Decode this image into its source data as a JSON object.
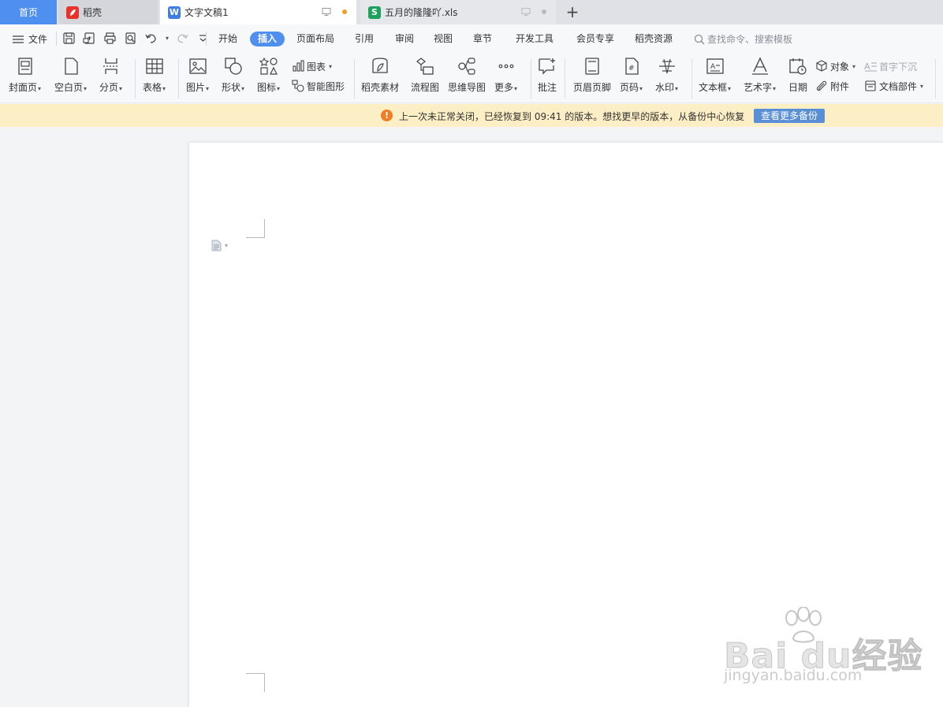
{
  "tabs": {
    "home": "首页",
    "daoke": "稻壳",
    "doc": "文字文稿1",
    "xls": "五月的隆隆吖.xls",
    "add": "+"
  },
  "menu": {
    "file": "文件",
    "items": [
      "开始",
      "插入",
      "页面布局",
      "引用",
      "审阅",
      "视图",
      "章节",
      "开发工具",
      "会员专享",
      "稻壳资源"
    ],
    "active": "插入",
    "search_placeholder": "查找命令、搜索模板"
  },
  "ribbon": {
    "cover": "封面页",
    "blank": "空白页",
    "pagebreak": "分页",
    "table": "表格",
    "picture": "图片",
    "shape": "形状",
    "icon": "图标",
    "chart": "图表",
    "smartart": "智能图形",
    "daoke_material": "稻壳素材",
    "flowchart": "流程图",
    "mindmap": "思维导图",
    "more": "更多",
    "comment": "批注",
    "header_footer": "页眉页脚",
    "page_number": "页码",
    "watermark": "水印",
    "textbox": "文本框",
    "wordart": "艺术字",
    "date": "日期",
    "object": "对象",
    "attachment": "附件",
    "dropcap": "首字下沉",
    "doc_parts": "文档部件"
  },
  "notice": {
    "text": "上一次未正常关闭，已经恢复到 09:41 的版本。想找更早的版本，从备份中心恢复",
    "button": "查看更多备份",
    "icon_color": "#f07c23"
  },
  "watermark": {
    "main": "Bai du经验",
    "sub": "jingyan.baidu.com"
  },
  "colors": {
    "accent": "#4f8ff0",
    "notice_bg": "#fcefc5"
  }
}
